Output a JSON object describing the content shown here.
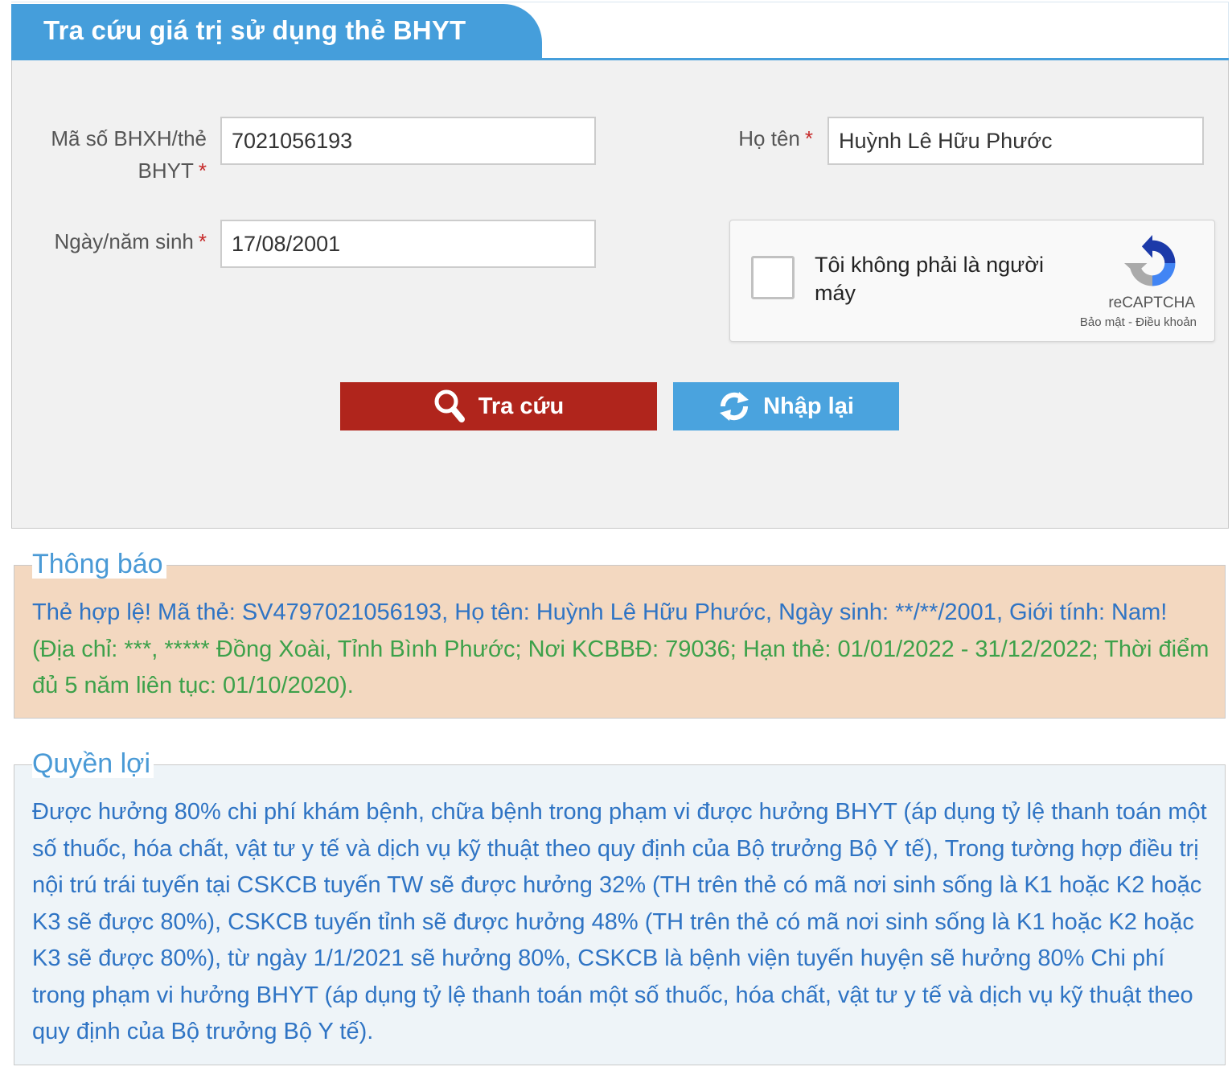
{
  "header": {
    "title": "Tra cứu giá trị sử dụng thẻ BHYT"
  },
  "form": {
    "card_label_line1": "Mã số BHXH/thẻ",
    "card_label_line2": "BHYT",
    "card_value": "7021056193",
    "name_label": "Họ tên",
    "name_value": "Huỳnh Lê Hữu Phước",
    "dob_label": "Ngày/năm sinh",
    "dob_value": "17/08/2001",
    "required_mark": "*"
  },
  "captcha": {
    "text": "Tôi không phải là người máy",
    "brand": "reCAPTCHA",
    "links": "Bảo mật - Điều khoản"
  },
  "buttons": {
    "search_label": "Tra cứu",
    "reset_label": "Nhập lại"
  },
  "notice": {
    "legend": "Thông báo",
    "primary": "Thẻ hợp lệ! Mã thẻ: SV4797021056193, Họ tên: Huỳnh Lê Hữu Phước, Ngày sinh: **/**/2001, Giới tính: Nam!",
    "secondary": " (Địa chỉ: ***, ***** Đồng Xoài, Tỉnh Bình Phước; Nơi KCBBĐ: 79036; Hạn thẻ: 01/01/2022 - 31/12/2022; Thời điểm đủ 5 năm liên tục: 01/10/2020)."
  },
  "benefit": {
    "legend": "Quyền lợi",
    "text": "Được hưởng 80% chi phí khám bệnh, chữa bệnh trong phạm vi được hưởng BHYT (áp dụng tỷ lệ thanh toán một số thuốc, hóa chất, vật tư y tế và dịch vụ kỹ thuật theo quy định của Bộ trưởng Bộ Y tế), Trong tường hợp điều trị nội trú trái tuyến tại CSKCB tuyến TW sẽ được hưởng 32% (TH trên thẻ có mã nơi sinh sống là K1 hoặc K2 hoặc K3 sẽ được 80%), CSKCB tuyến tỉnh sẽ được hưởng 48% (TH trên thẻ có mã nơi sinh sống là K1 hoặc K2 hoặc K3 sẽ được 80%), từ ngày 1/1/2021 sẽ hưởng 80%, CSKCB là bệnh viện tuyến huyện sẽ hưởng 80% Chi phí trong phạm vi hưởng BHYT (áp dụng tỷ lệ thanh toán một số thuốc, hóa chất, vật tư y tế và dịch vụ kỹ thuật theo quy định của Bộ trưởng Bộ Y tế)."
  },
  "icons": {
    "search": "search-icon",
    "reset": "refresh-icon",
    "captcha": "recaptcha-logo-icon"
  },
  "colors": {
    "header_blue": "#459edb",
    "search_button": "#b0251c",
    "reset_button": "#4aa3de",
    "notice_bg": "#f3d8c0",
    "notice_green": "#3da14a",
    "text_blue": "#2f74c4"
  }
}
